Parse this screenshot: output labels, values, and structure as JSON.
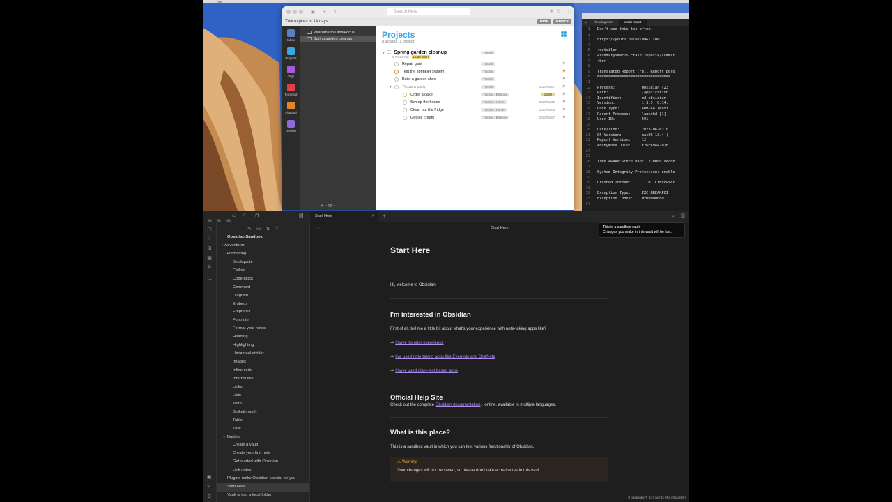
{
  "menubar": {
    "items": [
      "Help"
    ]
  },
  "omnifocus": {
    "search_placeholder": "Search Here",
    "trial_text": "Trial expires in 14 days",
    "hide_label": "Hide",
    "unlock_label": "Unlock",
    "rail": [
      {
        "label": "Inbox",
        "color": "#5b7fc7"
      },
      {
        "label": "Projects",
        "color": "#3da6e0"
      },
      {
        "label": "Tags",
        "color": "#a659d8"
      },
      {
        "label": "Forecast",
        "color": "#e0404a"
      },
      {
        "label": "Flagged",
        "color": "#e0852a"
      },
      {
        "label": "Review",
        "color": "#8a6bd8"
      }
    ],
    "sidebar": [
      "Welcome to OmniFocus",
      "Spring garden cleanup"
    ],
    "sidebar_bottom": "+ ◦ ⚙ ◦",
    "title": "Projects",
    "subtitle": "8 actions, 1 project",
    "project": {
      "name": "Spring garden cleanup",
      "remaining": "8 remaining ·",
      "due": "1 due soon",
      "tag": "Tutorial"
    },
    "tasks": [
      {
        "name": "Repair gate",
        "tag": "Tutorial",
        "date": "",
        "flag": false,
        "indent": 0,
        "color": "#bbb"
      },
      {
        "name": "Test the sprinkler system",
        "tag": "Tutorial",
        "date": "",
        "flag": true,
        "indent": 0,
        "color": "#e0852a"
      },
      {
        "name": "Build a garden shed",
        "tag": "Tutorial",
        "date": "",
        "flag": false,
        "indent": 0,
        "color": "#bbb"
      },
      {
        "name": "Throw a party",
        "tag": "Tutorial",
        "date": "2023/06/07",
        "flag": false,
        "indent": 0,
        "color": "#bbb",
        "group": true
      },
      {
        "name": "Order a cake",
        "tag": "Tutorial : Errands",
        "date": "18:00",
        "flag": false,
        "indent": 1,
        "color": "#e6c34a",
        "highlight": true
      },
      {
        "name": "Sweep the house",
        "tag": "Tutorial : Home",
        "date": "2023/06/05",
        "flag": false,
        "indent": 1,
        "color": "#bbb"
      },
      {
        "name": "Clean out the fridge",
        "tag": "Tutorial : Home",
        "date": "2023/06/05",
        "flag": false,
        "indent": 1,
        "color": "#bbb"
      },
      {
        "name": "Get ice cream",
        "tag": "Tutorial : Errands",
        "date": "2023/06/07",
        "flag": false,
        "indent": 1,
        "color": "#bbb"
      }
    ]
  },
  "editor": {
    "tabs": [
      "headings.css",
      "crash-report"
    ],
    "lines": [
      [
        "1",
        "Don't see this too often."
      ],
      [
        "2",
        ""
      ],
      [
        "3",
        "https://youtu.be/oeludGT1X0w"
      ],
      [
        "4",
        ""
      ],
      [
        "5",
        "<details>"
      ],
      [
        "6",
        "<summary>macOS crash report</summar"
      ],
      [
        "7",
        "<br>"
      ],
      [
        "8",
        ""
      ],
      [
        "9",
        "Translated Report (Full Report Belo"
      ],
      [
        "10",
        "================================="
      ],
      [
        "11",
        ""
      ],
      [
        "12",
        "Process:            Obsidian [23"
      ],
      [
        "13",
        "Path:               /Application"
      ],
      [
        "14",
        "Identifier:         md.obsidian"
      ],
      [
        "15",
        "Version:            1.3.5 (0.14."
      ],
      [
        "16",
        "Code Type:          ARM-64 (Nati"
      ],
      [
        "17",
        "Parent Process:     launchd [1]"
      ],
      [
        "18",
        "User ID:            501"
      ],
      [
        "19",
        ""
      ],
      [
        "20",
        "Date/Time:          2023-06-03 0"
      ],
      [
        "21",
        "OS Version:         macOS 13.4 ("
      ],
      [
        "22",
        "Report Version:     12"
      ],
      [
        "23",
        "Anonymous UUID:     F26E69A4-01F"
      ],
      [
        "24",
        ""
      ],
      [
        "25",
        ""
      ],
      [
        "26",
        "Time Awake Since Boot: 220000 secon"
      ],
      [
        "27",
        ""
      ],
      [
        "28",
        "System Integrity Protection: enable"
      ],
      [
        "29",
        ""
      ],
      [
        "30",
        "Crashed Thread:        0  CrBrowser"
      ],
      [
        "31",
        ""
      ],
      [
        "32",
        "Exception Type:     EXC_BREAKPOI"
      ],
      [
        "33",
        "Exception Codes:    0x00000000"
      ],
      [
        "34",
        ""
      ]
    ]
  },
  "obsidian": {
    "tab_label": "Start Here",
    "breadcrumb": "Start Here",
    "notice_line1": "This is a sandbox vault.",
    "notice_line2": "Changes you make in this vault will be lost.",
    "vault_name": "Obsidian Sandbox",
    "tree": [
      {
        "label": "Adventurer",
        "level": 1,
        "arrow": "›"
      },
      {
        "label": "Formatting",
        "level": 1,
        "arrow": "⌄"
      },
      {
        "label": "Blockquote",
        "level": 2
      },
      {
        "label": "Callout",
        "level": 2
      },
      {
        "label": "Code block",
        "level": 2
      },
      {
        "label": "Comment",
        "level": 2
      },
      {
        "label": "Diagram",
        "level": 2
      },
      {
        "label": "Embeds",
        "level": 2
      },
      {
        "label": "Emphasis",
        "level": 2
      },
      {
        "label": "Footnote",
        "level": 2
      },
      {
        "label": "Format your notes",
        "level": 2
      },
      {
        "label": "Heading",
        "level": 2
      },
      {
        "label": "Highlighting",
        "level": 2
      },
      {
        "label": "Horizontal divider",
        "level": 2
      },
      {
        "label": "Images",
        "level": 2
      },
      {
        "label": "Inline code",
        "level": 2
      },
      {
        "label": "Internal link",
        "level": 2
      },
      {
        "label": "Links",
        "level": 2
      },
      {
        "label": "Lists",
        "level": 2
      },
      {
        "label": "Math",
        "level": 2
      },
      {
        "label": "Strikethrough",
        "level": 2
      },
      {
        "label": "Table",
        "level": 2
      },
      {
        "label": "Task",
        "level": 2
      },
      {
        "label": "Guides",
        "level": 1,
        "arrow": "⌄"
      },
      {
        "label": "Create a vault",
        "level": 2
      },
      {
        "label": "Create your first note",
        "level": 2
      },
      {
        "label": "Get started with Obsidian",
        "level": 2
      },
      {
        "label": "Link notes",
        "level": 2
      },
      {
        "label": "Plugins make Obsidian special for you",
        "level": 0
      },
      {
        "label": "Start Here",
        "level": 0,
        "selected": true
      },
      {
        "label": "Vault is just a local folder",
        "level": 0
      }
    ],
    "doc": {
      "title": "Start Here",
      "welcome": "Hi, welcome to Obsidian!",
      "h_interested": "I'm interested in Obsidian",
      "p_first": "First of all, tell me a little bit about what's your experience with note-taking apps like?",
      "link1": "I have no prior experience",
      "link2": "I've used note-taking apps like Evernote and OneNote",
      "link3": "I have used plain-text based apps",
      "arrow": "->",
      "h_help": "Official Help Site",
      "p_help_pre": "Check out the complete",
      "help_link": "Obsidian documentation",
      "p_help_post": "online, available in multiple languages.",
      "h_what": "What is this place?",
      "p_what": "This is a sandbox vault in which you can test various functionality of Obsidian.",
      "warn_title": "Warning",
      "warn_text": "Your changes will not be saved, so please don't take actual notes in this vault."
    },
    "status": "0 backlinks  ✎  147 words  954 characters"
  }
}
